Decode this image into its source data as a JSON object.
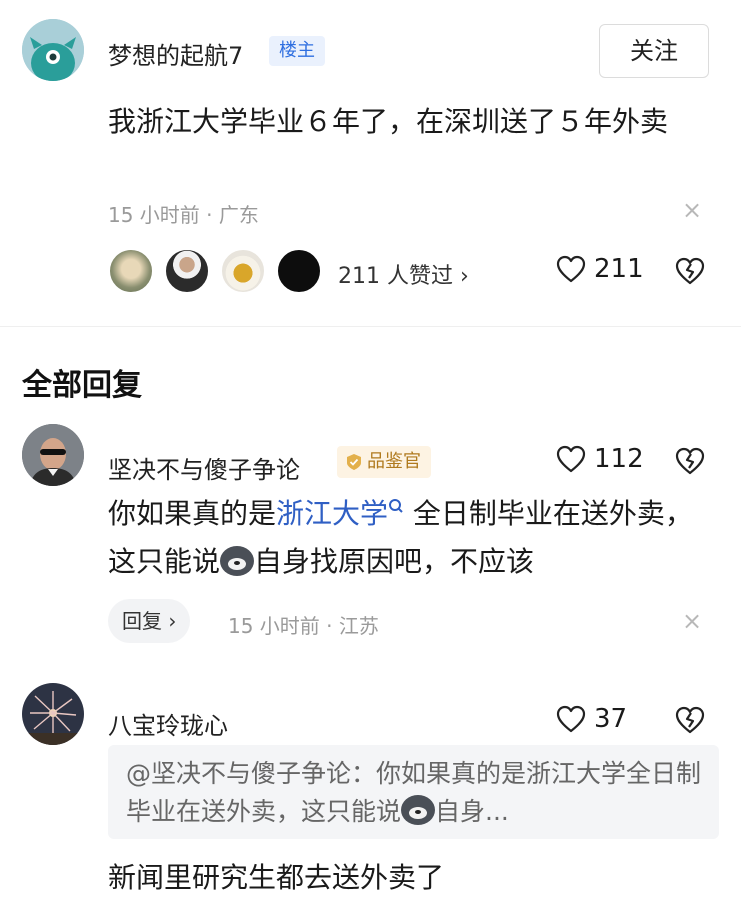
{
  "post": {
    "author": "梦想的起航7",
    "author_badge": "楼主",
    "follow_label": "关注",
    "text": "我浙江大学毕业６年了，在深圳送了５年外卖",
    "time_location": "15 小时前 · 广东",
    "close_glyph": "×",
    "likers_text": "211 人赞过 ›",
    "like_count": "211"
  },
  "section": {
    "title": "全部回复"
  },
  "comments": [
    {
      "author": "坚决不与傻子争论",
      "badge": "品鉴官",
      "like_count": "112",
      "text_part1": "你如果真的是",
      "link_text": "浙江大学",
      "text_part2": " 全日制毕业在送外卖，这只能说",
      "text_part3": "自身找原因吧，不应该",
      "reply_label": "回复 ›",
      "time_location": "15 小时前 · 江苏",
      "close_glyph": "×"
    },
    {
      "author": "八宝玲珑心",
      "like_count": "37",
      "quote_part1": "@坚决不与傻子争论：你如果真的是浙江大学全日制毕业在送外卖，这只能说",
      "quote_part2": "自身...",
      "text": "新闻里研究生都去送外卖了"
    }
  ],
  "colors": {
    "link": "#2f5fc4",
    "badge_blue": "#2f6fe0",
    "badge_gold": "#b07a1e",
    "meta_gray": "#9a9a9a"
  }
}
